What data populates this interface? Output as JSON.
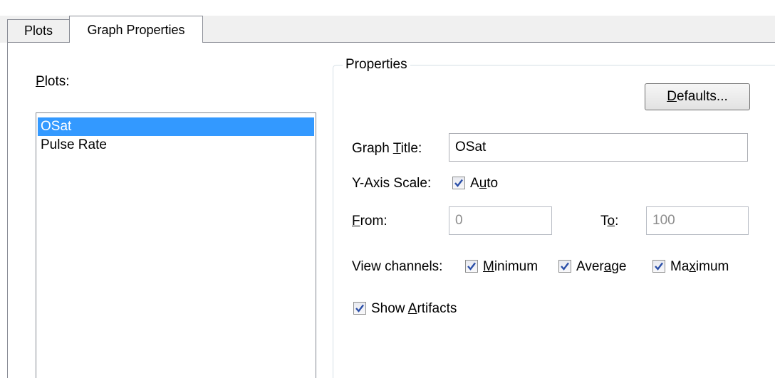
{
  "tabs": {
    "plots": "Plots",
    "graph_properties": "Graph Properties"
  },
  "plots_panel": {
    "label": "Plots:",
    "items": [
      "OSat",
      "Pulse Rate"
    ],
    "selected": "OSat"
  },
  "properties": {
    "group_title": "Properties",
    "defaults_button": "Defaults...",
    "graph_title_label": "Graph Title:",
    "graph_title_value": "OSat",
    "y_axis_scale_label": "Y-Axis Scale:",
    "auto_label": "Auto",
    "auto_checked": true,
    "from_label": "From:",
    "from_value": "0",
    "to_label": "To:",
    "to_value": "100",
    "view_channels_label": "View channels:",
    "minimum_label": "Minimum",
    "minimum_checked": true,
    "average_label": "Average",
    "average_checked": true,
    "maximum_label": "Maximum",
    "maximum_checked": true,
    "show_artifacts_label": "Show Artifacts",
    "show_artifacts_checked": true
  },
  "colors": {
    "selection": "#3399ff",
    "check": "#2b4fa8"
  }
}
